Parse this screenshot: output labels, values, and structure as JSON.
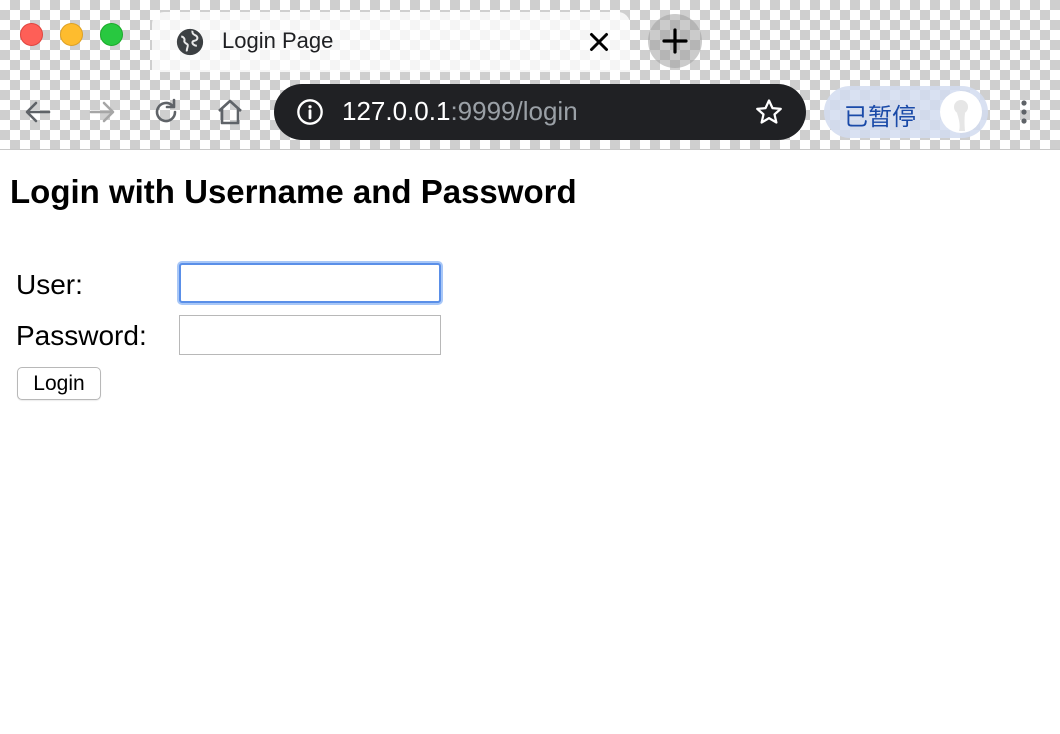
{
  "browser": {
    "tab": {
      "title": "Login Page",
      "favicon": "globe-icon"
    },
    "address_bar": {
      "host": "127.0.0.1",
      "path": ":9999/login",
      "info_icon": "info-icon",
      "bookmark_icon": "star-icon"
    },
    "profile": {
      "status_label": "已暂停",
      "avatar": "person-icon"
    },
    "nav": {
      "back": "back-arrow-icon",
      "forward": "forward-arrow-icon",
      "reload": "reload-icon",
      "home": "home-icon",
      "menu": "more-vertical-icon"
    }
  },
  "page": {
    "heading": "Login with Username and Password",
    "form": {
      "user_label": "User:",
      "user_value": "",
      "password_label": "Password:",
      "password_value": "",
      "submit_label": "Login"
    }
  },
  "colors": {
    "omnibox_bg": "#202124",
    "focus_ring": "#5a8fe8",
    "paused_text": "#1a4aa8"
  }
}
